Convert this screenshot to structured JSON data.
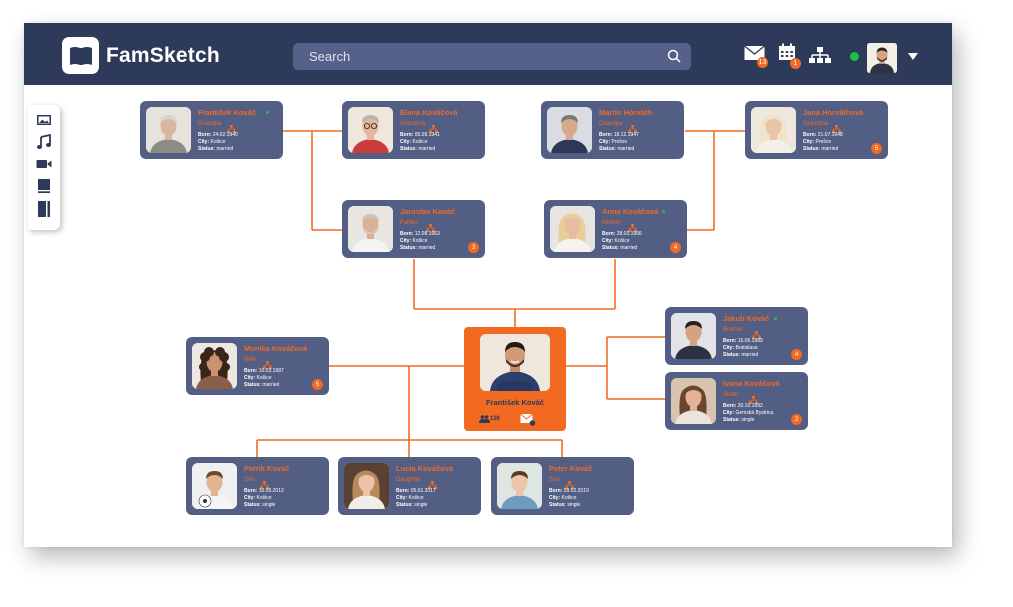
{
  "app": {
    "name": "FamSketch"
  },
  "search": {
    "placeholder": "Search"
  },
  "toolbar": {
    "mail_badge": "13",
    "calendar_badge": "1"
  },
  "colors": {
    "accent": "#f26a21",
    "navbar": "#2e3a59",
    "card": "#535e85",
    "online": "#1fbf4c"
  },
  "sidebar_tools": [
    "image-icon",
    "music-icon",
    "video-icon",
    "book-icon",
    "notebook-icon"
  ],
  "center": {
    "name": "František Kováč",
    "connections": "126"
  },
  "cards": [
    {
      "key": "frantisek_sr",
      "name": "František Kováč",
      "role": "Grandpa",
      "born": "24.02.1940",
      "city": "Košice",
      "status": "married",
      "badge": ""
    },
    {
      "key": "elena",
      "name": "Elena Kováčová",
      "role": "Grandma",
      "born": "05.09.1941",
      "city": "Košice",
      "status": "married",
      "badge": ""
    },
    {
      "key": "martin",
      "name": "Martin Horváth",
      "role": "Grandpa",
      "born": "18.12.1947",
      "city": "Prešov",
      "status": "married",
      "badge": ""
    },
    {
      "key": "jana",
      "name": "Jana Horváthová",
      "role": "Grandma",
      "born": "21.07.1948",
      "city": "Prešov",
      "status": "married",
      "badge": "5"
    },
    {
      "key": "jaroslav",
      "name": "Jaroslav Kováč",
      "role": "Father",
      "born": "12.08.1963",
      "city": "Košice",
      "status": "married",
      "badge": "3"
    },
    {
      "key": "anna",
      "name": "Anna Kováčová",
      "role": "Mother",
      "born": "28.03.1966",
      "city": "Košice",
      "status": "married",
      "badge": "4"
    },
    {
      "key": "monika",
      "name": "Monika Kováčová",
      "role": "Wife",
      "born": "10.03.1987",
      "city": "Košice",
      "status": "married",
      "badge": "5"
    },
    {
      "key": "jakub",
      "name": "Jakub Kováč",
      "role": "Brother",
      "born": "15.06.1989",
      "city": "Bratislava",
      "status": "married",
      "badge": "4"
    },
    {
      "key": "ivana",
      "name": "Ivana Kováčová",
      "role": "Sister",
      "born": "20.10.1992",
      "city": "Gemská Bystrica",
      "status": "single",
      "badge": "2"
    },
    {
      "key": "patrik",
      "name": "Patrik Kováč",
      "role": "Son",
      "born": "10.05.2012",
      "city": "Košice",
      "status": "single",
      "badge": ""
    },
    {
      "key": "lucia",
      "name": "Lucia Kováčová",
      "role": "Daughter",
      "born": "05.01.2017",
      "city": "Košice",
      "status": "single",
      "badge": ""
    },
    {
      "key": "peter",
      "name": "Peter Kováč",
      "role": "Son",
      "born": "09.02.2019",
      "city": "Košice",
      "status": "single",
      "badge": ""
    }
  ],
  "labels": {
    "born": "Born:",
    "city": "City:",
    "status": "Status:"
  }
}
